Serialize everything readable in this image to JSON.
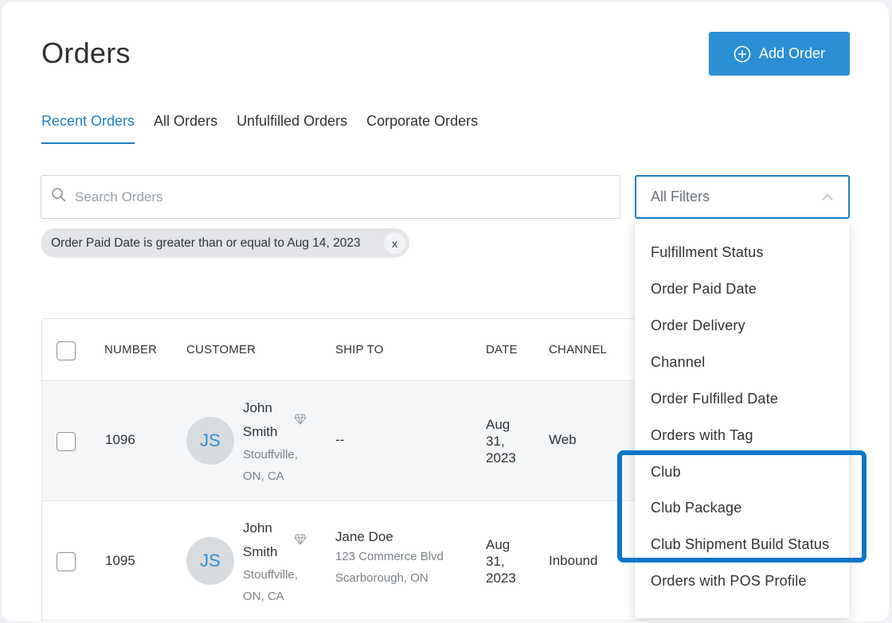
{
  "page": {
    "title": "Orders"
  },
  "header": {
    "add_button_label": "Add Order"
  },
  "tabs": [
    {
      "label": "Recent Orders",
      "active": true
    },
    {
      "label": "All Orders",
      "active": false
    },
    {
      "label": "Unfulfilled Orders",
      "active": false
    },
    {
      "label": "Corporate Orders",
      "active": false
    }
  ],
  "search": {
    "placeholder": "Search Orders",
    "value": ""
  },
  "filters": {
    "label": "All Filters",
    "menu_open": true,
    "options": [
      "Fulfillment Status",
      "Order Paid Date",
      "Order Delivery",
      "Channel",
      "Order Fulfilled Date",
      "Orders with Tag",
      "Club",
      "Club Package",
      "Club Shipment Build Status",
      "Orders with POS Profile"
    ]
  },
  "active_filter_chip": {
    "text": "Order Paid Date is greater than or equal to Aug 14, 2023",
    "close_label": "x"
  },
  "table": {
    "columns": [
      "NUMBER",
      "CUSTOMER",
      "SHIP TO",
      "DATE",
      "CHANNEL"
    ],
    "rows": [
      {
        "number": "1096",
        "initials": "JS",
        "first_name": "John",
        "last_name": "Smith",
        "city": "Stouffville,",
        "region": "ON, CA",
        "ship_name": "--",
        "ship_line1": "",
        "ship_line2": "",
        "date_month": "Aug",
        "date_day": "31,",
        "date_year": "2023",
        "channel": "Web"
      },
      {
        "number": "1095",
        "initials": "JS",
        "first_name": "John",
        "last_name": "Smith",
        "city": "Stouffville,",
        "region": "ON, CA",
        "ship_name": "Jane Doe",
        "ship_line1": "123 Commerce Blvd",
        "ship_line2": "Scarborough, ON",
        "date_month": "Aug",
        "date_day": "31,",
        "date_year": "2023",
        "channel": "Inbound"
      }
    ]
  },
  "colors": {
    "accent": "#2b8fd6",
    "tab_active": "#1e7fc7",
    "highlight_box": "#0a77c8"
  },
  "icons": {
    "add": "plus-circle-icon",
    "search": "search-icon",
    "filters": "chevron-up-icon",
    "vip": "diamond-icon"
  }
}
